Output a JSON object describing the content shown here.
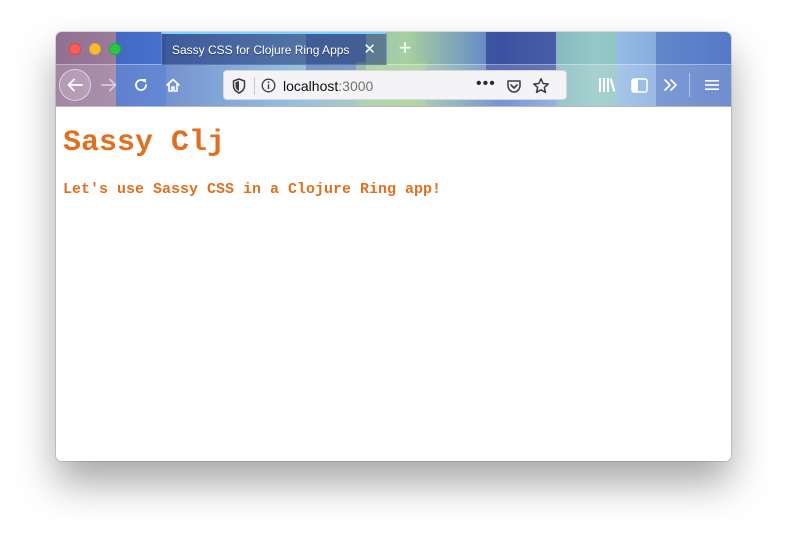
{
  "browser": {
    "tab_title": "Sassy CSS for Clojure Ring Apps",
    "url_host": "localhost",
    "url_port": ":3000",
    "theme_colors": {
      "accent": "#7fd3ff",
      "tab_background": "#2f4a8c",
      "urlbar_background": "#f4f4f6"
    },
    "icons": {
      "back": "back-arrow-icon",
      "forward": "forward-arrow-icon",
      "reload": "reload-icon",
      "home": "home-icon",
      "tracking": "shield-icon",
      "info": "info-icon",
      "page_actions": "more-horizontal-icon",
      "pocket": "pocket-icon",
      "bookmark": "star-icon",
      "library": "library-icon",
      "sidebar": "sidebar-icon",
      "overflow": "chevrons-right-icon",
      "menu": "hamburger-menu-icon",
      "close_tab": "close-icon",
      "new_tab": "plus-icon"
    }
  },
  "page": {
    "heading": "Sassy Clj",
    "subtext": "Let's use Sassy CSS in a Clojure Ring app!",
    "text_color": "#e07020"
  }
}
